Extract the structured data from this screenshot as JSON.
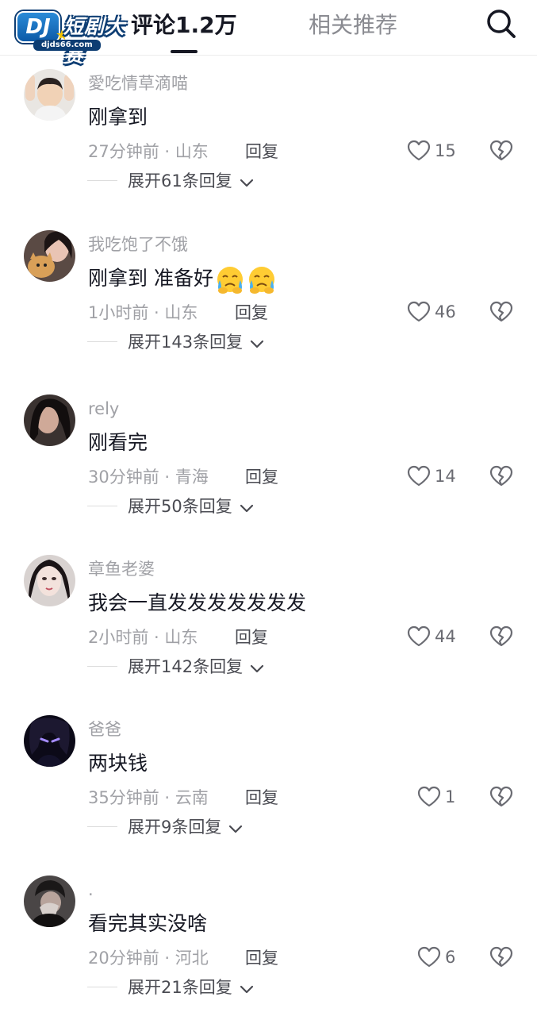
{
  "logo": {
    "badge": "DJ",
    "text": "短剧大赛",
    "url": "djds66.com"
  },
  "tabs": {
    "comments": "评论1.2万",
    "related": "相关推荐"
  },
  "reply_label": "回复",
  "comments": [
    {
      "username": "愛吃情草滴喵",
      "content": "刚拿到",
      "emoji_count": 0,
      "time": "27分钟前",
      "location": "山东",
      "likes": "15",
      "expand": "展开61条回复"
    },
    {
      "username": "我吃饱了不饿",
      "content": "刚拿到 准备好",
      "emoji_count": 2,
      "emoji": "crying-face",
      "time": "1小时前",
      "location": "山东",
      "likes": "46",
      "expand": "展开143条回复"
    },
    {
      "username": "rely",
      "content": "刚看完",
      "emoji_count": 0,
      "time": "30分钟前",
      "location": "青海",
      "likes": "14",
      "expand": "展开50条回复"
    },
    {
      "username": "章鱼老婆",
      "content": "我会一直发发发发发发发",
      "emoji_count": 0,
      "time": "2小时前",
      "location": "山东",
      "likes": "44",
      "expand": "展开142条回复"
    },
    {
      "username": "爸爸",
      "content": "两块钱",
      "emoji_count": 0,
      "time": "35分钟前",
      "location": "云南",
      "likes": "1",
      "expand": "展开9条回复"
    },
    {
      "username": ".",
      "content": "看完其实没啥",
      "emoji_count": 0,
      "time": "20分钟前",
      "location": "河北",
      "likes": "6",
      "expand": "展开21条回复"
    }
  ],
  "colors": {
    "accent_text": "#161823",
    "secondary_text": "#a0a1a6",
    "logo_blue": "#0d3d73",
    "logo_star": "#f5c400"
  },
  "icons": {
    "search": "search-icon",
    "like": "heart-icon",
    "dislike": "broken-heart-icon",
    "expand": "chevron-down-icon"
  }
}
